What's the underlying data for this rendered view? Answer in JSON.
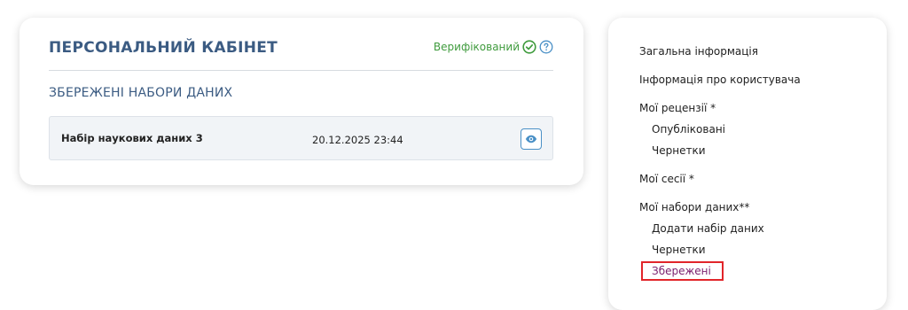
{
  "cabinet": {
    "title": "ПЕРСОНАЛЬНИЙ КАБІНЕТ",
    "verified_label": "Верифікований",
    "verified_color": "#3f9b3d",
    "section_title": "ЗБЕРЕЖЕНІ НАБОРИ ДАНИХ",
    "datasets": [
      {
        "name": "Набір наукових даних 3",
        "date": "20.12.2025 23:44",
        "action_icon": "eye-icon"
      }
    ]
  },
  "sidebar": {
    "items": [
      {
        "label": "Загальна інформація"
      },
      {
        "label": "Інформація про користувача"
      },
      {
        "label": "Мої рецензії *"
      },
      {
        "label": "Опубліковані"
      },
      {
        "label": "Чернетки"
      },
      {
        "label": "Мої сесії *"
      },
      {
        "label": "Мої набори даних**"
      },
      {
        "label": "Додати набір даних"
      },
      {
        "label": "Чернетки"
      },
      {
        "label": "Збережені"
      }
    ],
    "active_item": "Збережені",
    "active_outline_color": "#e1252a"
  }
}
